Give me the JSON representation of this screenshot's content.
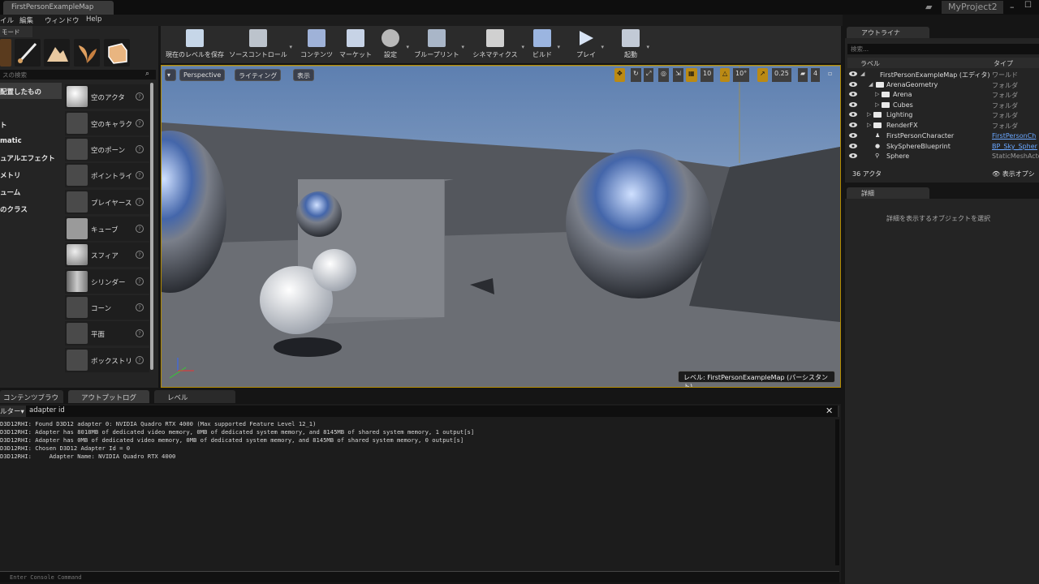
{
  "window": {
    "tab_title": "FirstPersonExampleMap",
    "project_name": "MyProject2"
  },
  "menubar": {
    "items": [
      "イル",
      "編集",
      "ウィンドウ",
      "Help"
    ]
  },
  "modes_panel": {
    "tab_label": "モード",
    "search_placeholder": "スの検索",
    "categories": [
      "配置したもの",
      "ト",
      "matic",
      "ュアルエフェクト",
      "メトリ",
      "ューム",
      "のクラス"
    ],
    "actors": [
      "空のアクタ",
      "空のキャラク",
      "空のポーン",
      "ポイントライ",
      "プレイヤース",
      "キューブ",
      "スフィア",
      "シリンダー",
      "コーン",
      "平面",
      "ボックストリ"
    ]
  },
  "toolbar": {
    "buttons": [
      "現在のレベルを保存",
      "ソースコントロール",
      "コンテンツ",
      "マーケット",
      "設定",
      "ブループリント",
      "シネマティクス",
      "ビルド",
      "プレイ",
      "起動"
    ]
  },
  "viewport": {
    "perspective": "Perspective",
    "lighting": "ライティング",
    "show": "表示",
    "grid_snap": "10",
    "rotation_snap": "10°",
    "scale_snap": "0.25",
    "camera_speed": "4",
    "level_label": "レベル: FirstPersonExampleMap (パーシスタント)"
  },
  "bottom_tabs": [
    "コンテンツブラウザ",
    "アウトプットログ",
    "レベル"
  ],
  "output_log": {
    "filter_label": "ルター▾",
    "filter_value": "adapter id",
    "lines": [
      "D3D12RHI: Found D3D12 adapter 0: NVIDIA Quadro RTX 4000 (Max supported Feature Level 12_1)",
      "D3D12RHI: Adapter has 8018MB of dedicated video memory, 0MB of dedicated system memory, and 8145MB of shared system memory, 1 output[s]",
      "D3D12RHI: Adapter has 0MB of dedicated video memory, 0MB of dedicated system memory, and 8145MB of shared system memory, 0 output[s]",
      "D3D12RHI: Chosen D3D12 Adapter Id = 0",
      "D3D12RHI:     Adapter Name: NVIDIA Quadro RTX 4000"
    ],
    "console_placeholder": "Enter Console Command"
  },
  "outliner": {
    "tab_label": "アウトライナ",
    "search_placeholder": "検索...",
    "col_label": "ラベル",
    "col_type": "タイプ",
    "rows": [
      {
        "name": "FirstPersonExampleMap (エディタ)",
        "type": "ワールド"
      },
      {
        "name": "ArenaGeometry",
        "type": "フォルダ"
      },
      {
        "name": "Arena",
        "type": "フォルダ"
      },
      {
        "name": "Cubes",
        "type": "フォルダ"
      },
      {
        "name": "Lighting",
        "type": "フォルダ"
      },
      {
        "name": "RenderFX",
        "type": "フォルダ"
      },
      {
        "name": "FirstPersonCharacter",
        "type": "FirstPersonCh"
      },
      {
        "name": "SkySphereBlueprint",
        "type": "BP_Sky_Spher"
      },
      {
        "name": "Sphere",
        "type": "StaticMeshActo"
      }
    ],
    "actor_count": "36 アクタ",
    "view_options": "表示オプシ"
  },
  "details": {
    "tab_label": "詳細",
    "empty_message": "詳細を表示するオブジェクトを選択"
  },
  "colors": {
    "viewport_border": "#b28a00",
    "link": "#6aa7ff"
  }
}
